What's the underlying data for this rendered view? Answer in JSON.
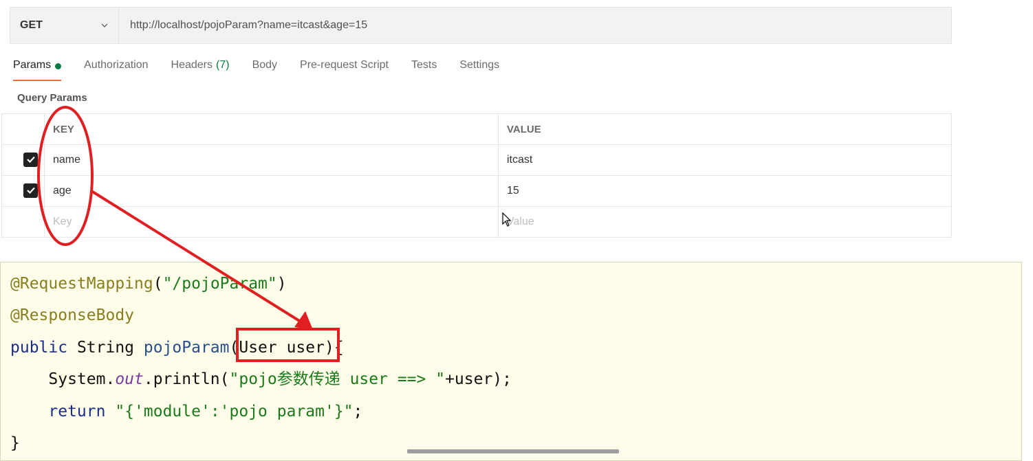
{
  "request": {
    "method": "GET",
    "url": "http://localhost/pojoParam?name=itcast&age=15"
  },
  "tabs": [
    {
      "label": "Params",
      "active": true,
      "indicator": "green-dot"
    },
    {
      "label": "Authorization"
    },
    {
      "label": "Headers",
      "count": "(7)"
    },
    {
      "label": "Body"
    },
    {
      "label": "Pre-request Script"
    },
    {
      "label": "Tests"
    },
    {
      "label": "Settings"
    }
  ],
  "query_params": {
    "title": "Query Params",
    "headers": {
      "key": "KEY",
      "value": "VALUE"
    },
    "rows": [
      {
        "checked": true,
        "key": "name",
        "value": "itcast"
      },
      {
        "checked": true,
        "key": "age",
        "value": "15"
      }
    ],
    "placeholder": {
      "key": "Key",
      "value": "Value"
    }
  },
  "code": {
    "line1": {
      "ann": "@RequestMapping",
      "p1": "(",
      "str": "\"/pojoParam\"",
      "p2": ")"
    },
    "line2": {
      "ann": "@ResponseBody"
    },
    "line3": {
      "kw": "public",
      "type": " String ",
      "fn": "pojoParam",
      "args": "(User user)",
      "end": "{"
    },
    "line4": {
      "obj": "System.",
      "field": "out",
      "call": ".println(",
      "str": "\"pojo参数传递 user ==> \"",
      "rest": "+user);"
    },
    "line5": {
      "kw": "return",
      "str": "\"{'module':'pojo param'}\"",
      "end": ";"
    },
    "line6": {
      "end": "}"
    }
  },
  "colors": {
    "accent_tab": "#f26b3a",
    "green": "#0c7a43",
    "annotation_red": "#e02020",
    "code_bg": "#fefde9"
  }
}
